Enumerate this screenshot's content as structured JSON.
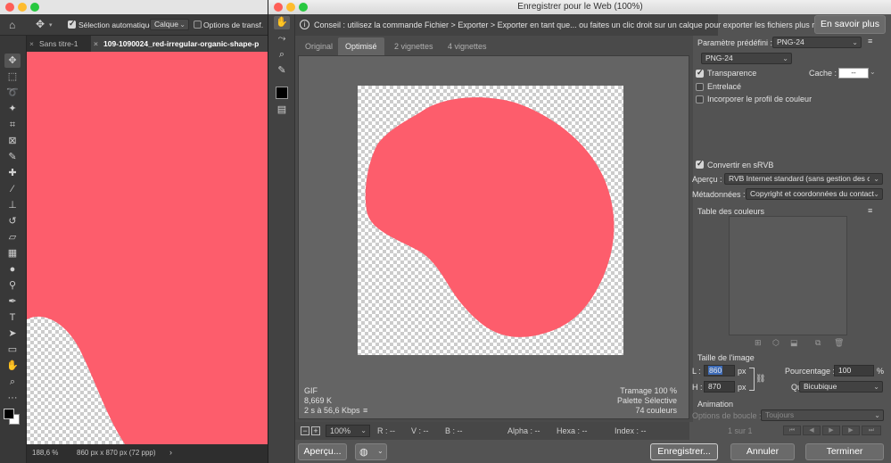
{
  "photoshop": {
    "options_bar": {
      "auto_select_label": "Sélection automatique :",
      "auto_select_value": "Calque",
      "transform_options_label": "Options de transf."
    },
    "tabs": [
      {
        "label": "Sans titre-1",
        "active": false
      },
      {
        "label": "109-1090024_red-irregular-organic-shape-p",
        "active": true
      }
    ],
    "status": {
      "zoom": "188,6 %",
      "doc_info": "860 px x 870 px (72 ppp)",
      "arrow": "›"
    },
    "canvas_color": "#fd5d6c"
  },
  "dialog": {
    "title": "Enregistrer pour le Web (100%)",
    "hint": {
      "text": "Conseil : utilisez la commande Fichier > Exporter > Exporter en tant que... ou faites un clic droit sur un calque pour exporter les fichiers plus rapidement.",
      "learn_more": "En savoir plus"
    },
    "view_tabs": [
      "Original",
      "Optimisé",
      "2 vignettes",
      "4 vignettes"
    ],
    "active_view_tab": "Optimisé",
    "preview_info": {
      "format": "GIF",
      "size": "8,669 K",
      "time": "2 s à 56,6 Kbps",
      "time_menu_icon": "≡",
      "dither": "Tramage 100 %",
      "palette": "Palette Sélective",
      "colors": "74 couleurs"
    },
    "bottom_bar": {
      "zoom_minus": "−",
      "zoom_plus": "+",
      "zoom": "100%",
      "r": "R : --",
      "g": "V : --",
      "b": "B : --",
      "alpha": "Alpha : --",
      "hex": "Hexa : --",
      "index": "Index : --"
    },
    "buttons": {
      "preview": "Aperçu...",
      "save": "Enregistrer...",
      "cancel": "Annuler",
      "done": "Terminer"
    },
    "settings": {
      "preset_label": "Paramètre prédéfini :",
      "preset_value": "PNG-24",
      "format_value": "PNG-24",
      "transparency_label": "Transparence",
      "transparency_checked": true,
      "matte_label": "Cache :",
      "matte_value": "--",
      "interlaced_label": "Entrelacé",
      "embed_profile_label": "Incorporer le profil de couleur",
      "convert_srgb_label": "Convertir en sRVB",
      "preview_label": "Aperçu :",
      "preview_value": "RVB Internet standard (sans gestion des c...",
      "metadata_label": "Métadonnées :",
      "metadata_value": "Copyright et coordonnées du contact",
      "color_table_label": "Table des couleurs",
      "image_size_label": "Taille de l'image",
      "width_label": "L :",
      "width_value": "860",
      "height_label": "H :",
      "height_value": "870",
      "unit_px": "px",
      "percent_label": "Pourcentage :",
      "percent_value": "100",
      "percent_unit": "%",
      "quality_label": "Qualité :",
      "quality_value": "Bicubique",
      "animation_label": "Animation",
      "loop_label": "Options de boucle :",
      "loop_value": "Toujours",
      "frame_counter": "1 sur 1"
    },
    "shape_color": "#fd5d6c"
  }
}
